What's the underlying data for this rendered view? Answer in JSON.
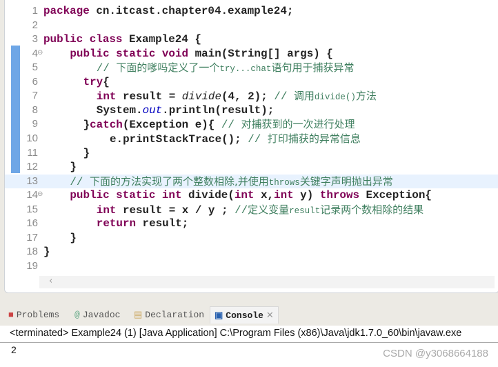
{
  "editor": {
    "current_line": 13,
    "lines": [
      {
        "n": "1",
        "indent": 0,
        "seg": [
          [
            "kw",
            "package"
          ],
          [
            "",
            "cn.itcast.chapter04.example24;"
          ]
        ]
      },
      {
        "n": "2",
        "indent": 0,
        "seg": []
      },
      {
        "n": "3",
        "indent": 0,
        "seg": [
          [
            "kw",
            "public class"
          ],
          [
            "",
            " Example24 {"
          ]
        ]
      },
      {
        "n": "4",
        "indent": 4,
        "fold": true,
        "seg": [
          [
            "kw",
            "public static void"
          ],
          [
            "",
            " main(String[] args) {"
          ]
        ]
      },
      {
        "n": "5",
        "indent": 8,
        "seg": [
          [
            "cm",
            "// "
          ],
          [
            "cn",
            "下面的嗲吗定义了一个"
          ],
          [
            "asc",
            "try...chat"
          ],
          [
            "cn",
            "语句用于捕获异常"
          ]
        ]
      },
      {
        "n": "6",
        "indent": 6,
        "seg": [
          [
            "kw",
            "try"
          ],
          [
            "",
            "{"
          ]
        ]
      },
      {
        "n": "7",
        "indent": 8,
        "seg": [
          [
            "kw",
            "int"
          ],
          [
            "",
            " result = "
          ],
          [
            "it",
            "divide"
          ],
          [
            "",
            "(4, 2); "
          ],
          [
            "cm",
            "// "
          ],
          [
            "cn",
            "调用"
          ],
          [
            "asc",
            "divide()"
          ],
          [
            "cn",
            "方法"
          ]
        ]
      },
      {
        "n": "8",
        "indent": 8,
        "seg": [
          [
            "",
            "System."
          ],
          [
            "fld",
            "out"
          ],
          [
            "",
            ".println(result);"
          ]
        ]
      },
      {
        "n": "9",
        "indent": 6,
        "seg": [
          [
            "",
            "}"
          ],
          [
            "kw",
            "catch"
          ],
          [
            "",
            "(Exception e){ "
          ],
          [
            "cm",
            "// "
          ],
          [
            "cn",
            "对捕获到的一次进行处理"
          ]
        ]
      },
      {
        "n": "10",
        "indent": 10,
        "seg": [
          [
            "",
            "e.printStackTrace(); "
          ],
          [
            "cm",
            "// "
          ],
          [
            "cn",
            "打印捕获的异常信息"
          ]
        ]
      },
      {
        "n": "11",
        "indent": 6,
        "seg": [
          [
            "",
            "}"
          ]
        ]
      },
      {
        "n": "12",
        "indent": 4,
        "seg": [
          [
            "",
            "}"
          ]
        ]
      },
      {
        "n": "13",
        "indent": 4,
        "seg": [
          [
            "cm",
            "// "
          ],
          [
            "cn",
            "下面的方法实现了两个整数相除,并使用"
          ],
          [
            "asc",
            "throws"
          ],
          [
            "cn",
            "关键字声明抛出异常"
          ]
        ]
      },
      {
        "n": "14",
        "indent": 4,
        "fold": true,
        "seg": [
          [
            "kw",
            "public static int"
          ],
          [
            "",
            " divide("
          ],
          [
            "kw",
            "int"
          ],
          [
            "",
            " x,"
          ],
          [
            "kw",
            "int"
          ],
          [
            "",
            " y) "
          ],
          [
            "kw",
            "throws"
          ],
          [
            "",
            " Exception{"
          ]
        ]
      },
      {
        "n": "15",
        "indent": 8,
        "seg": [
          [
            "kw",
            "int"
          ],
          [
            "",
            " result = x / y ; "
          ],
          [
            "cm",
            "//"
          ],
          [
            "cn",
            "定义变量"
          ],
          [
            "asc",
            "result"
          ],
          [
            "cn",
            "记录两个数相除的结果"
          ]
        ]
      },
      {
        "n": "16",
        "indent": 8,
        "seg": [
          [
            "kw",
            "return"
          ],
          [
            "",
            " result;"
          ]
        ]
      },
      {
        "n": "17",
        "indent": 4,
        "seg": [
          [
            "",
            "}"
          ]
        ]
      },
      {
        "n": "18",
        "indent": 0,
        "seg": [
          [
            "",
            "}"
          ]
        ]
      },
      {
        "n": "19",
        "indent": 0,
        "seg": []
      }
    ]
  },
  "tabs": [
    {
      "label": "Problems",
      "icon": "problems-icon"
    },
    {
      "label": "Javadoc",
      "icon": "at-icon"
    },
    {
      "label": "Declaration",
      "icon": "declaration-icon"
    },
    {
      "label": "Console",
      "icon": "console-icon",
      "active": true
    }
  ],
  "console": {
    "header": "<terminated> Example24 (1) [Java Application] C:\\Program Files (x86)\\Java\\jdk1.7.0_60\\bin\\javaw.exe",
    "output": "2"
  },
  "watermark": "CSDN @y3068664188",
  "colors": {
    "keyword": "#7f0055",
    "comment": "#3f7f5f",
    "field": "#0000c0",
    "current_line": "#e8f2fe"
  }
}
